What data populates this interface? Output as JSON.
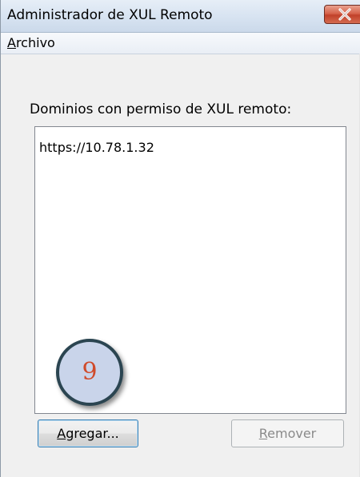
{
  "window": {
    "title": "Administrador de XUL Remoto",
    "close_icon": "close-icon"
  },
  "menubar": {
    "archivo_accel": "A",
    "archivo_rest": "rchivo"
  },
  "main": {
    "group_label": "Dominios con permiso de XUL remoto:",
    "domains": [
      "https://10.78.1.32"
    ]
  },
  "buttons": {
    "add_accel": "A",
    "add_rest": "gregar...",
    "remove_accel": "R",
    "remove_rest": "emover"
  },
  "annotation": {
    "step_number": "9"
  },
  "colors": {
    "close_button": "#d6634b",
    "step_number": "#d04a2a",
    "step_badge_fill": "#c9d4ea"
  }
}
